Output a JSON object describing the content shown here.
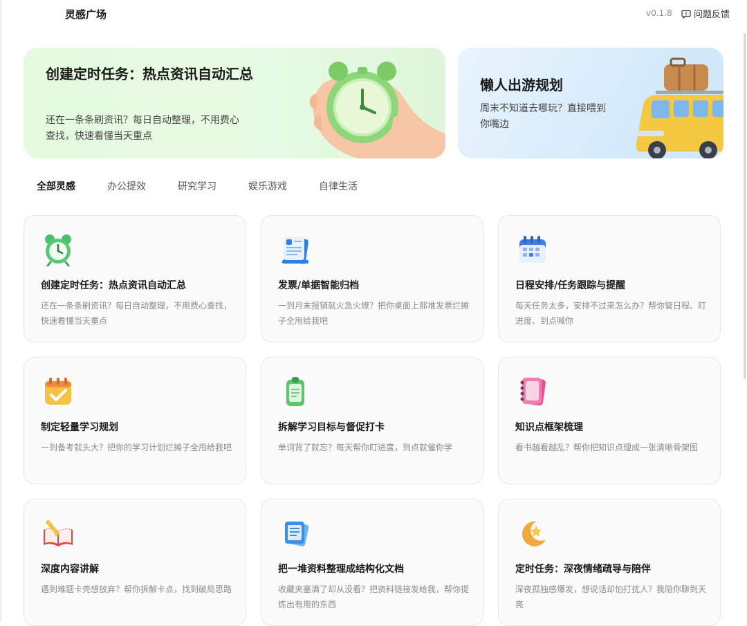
{
  "header": {
    "app_title": "灵感广场",
    "version": "v0.1.8",
    "feedback_label": "问题反馈"
  },
  "banners": [
    {
      "title": "创建定时任务：热点资讯自动汇总",
      "desc": "还在一条条刷资讯？每日自动整理，不用费心查找，快速看懂当天重点",
      "art": "alarm-clock-in-hand"
    },
    {
      "title": "懒人出游规划",
      "desc": "周末不知道去哪玩？直接喂到你嘴边",
      "art": "yellow-van-with-luggage"
    }
  ],
  "tabs": [
    {
      "label": "全部灵感",
      "active": true
    },
    {
      "label": "办公提效",
      "active": false
    },
    {
      "label": "研究学习",
      "active": false
    },
    {
      "label": "娱乐游戏",
      "active": false
    },
    {
      "label": "自律生活",
      "active": false
    }
  ],
  "cards": [
    {
      "icon": "alarm-clock-icon",
      "title": "创建定时任务：热点资讯自动汇总",
      "desc": "还在一条条刷资讯？每日自动整理，不用费心查找，快速看懂当天重点"
    },
    {
      "icon": "invoice-document-icon",
      "title": "发票/单据智能归档",
      "desc": "一到月末报销就火急火燎？把你桌面上那堆发票烂摊子全甩给我吧"
    },
    {
      "icon": "calendar-icon",
      "title": "日程安排/任务跟踪与提醒",
      "desc": "每天任务太多，安排不过来怎么办？帮你管日程、盯进度、到点喊你"
    },
    {
      "icon": "planner-check-icon",
      "title": "制定轻量学习规划",
      "desc": "一到备考就头大？把你的学习计划烂摊子全甩给我吧"
    },
    {
      "icon": "clipboard-icon",
      "title": "拆解学习目标与督促打卡",
      "desc": "单词背了就忘？每天帮你盯进度，到点就催你学"
    },
    {
      "icon": "notebook-icon",
      "title": "知识点框架梳理",
      "desc": "看书越看越乱？帮你把知识点理成一张清晰骨架图"
    },
    {
      "icon": "open-book-pencil-icon",
      "title": "深度内容讲解",
      "desc": "遇到难题卡壳想放弃？帮你拆解卡点，找到破局思路"
    },
    {
      "icon": "stacked-documents-icon",
      "title": "把一堆资料整理成结构化文档",
      "desc": "收藏夹塞满了却从没看？把资料链接发给我，帮你提炼出有用的东西"
    },
    {
      "icon": "moon-star-icon",
      "title": "定时任务：深夜情绪疏导与陪伴",
      "desc": "深夜孤独感爆发，想说话却怕打扰人？我陪你聊到天亮"
    }
  ],
  "colors": {
    "banner_green": "#e5fbe0",
    "banner_blue": "#dcedfb",
    "card_bg": "#fbfbfb",
    "card_border": "#e6e6e6",
    "muted_text": "#8a8a8a"
  }
}
